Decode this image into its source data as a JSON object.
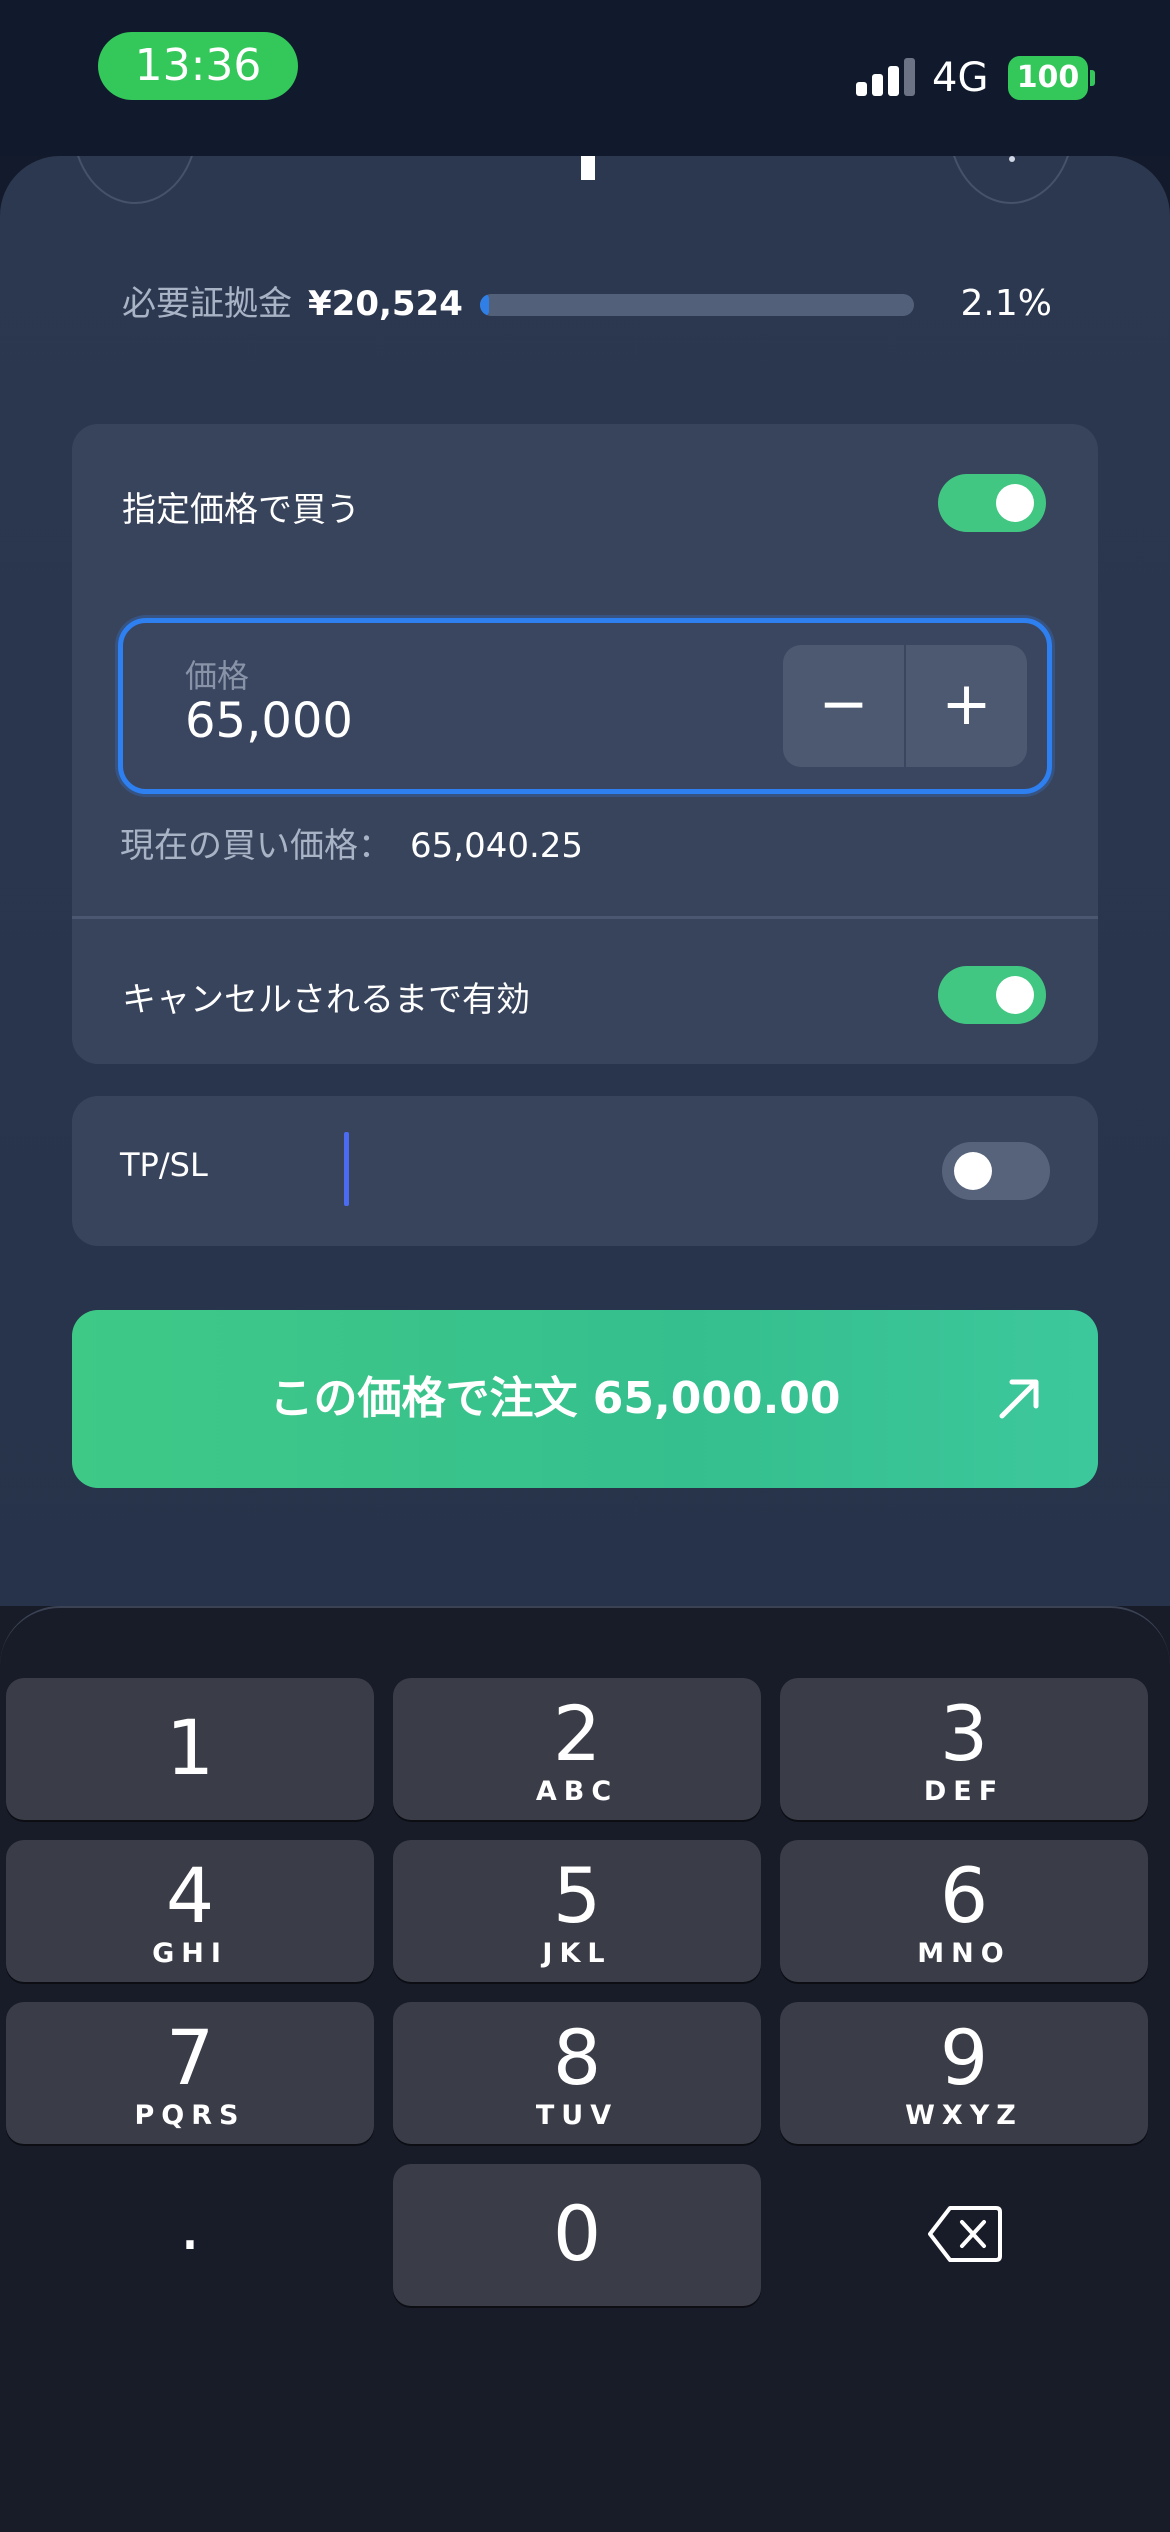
{
  "status_bar": {
    "time": "13:36",
    "network": "4G",
    "battery": "100",
    "time_pill_color": "#34c85a"
  },
  "margin": {
    "label": "必要証拠金",
    "value": "¥20,524",
    "percent": "2.1%",
    "fill_fraction": 0.021
  },
  "limit_order": {
    "label": "指定価格で買う",
    "toggle_on": true,
    "price_caption": "価格",
    "price_value": "65,000",
    "minus": "−",
    "plus": "+",
    "current_label": "現在の買い価格：",
    "current_value": "65,040.25"
  },
  "gtc": {
    "label": "キャンセルされるまで有効",
    "toggle_on": true
  },
  "tpsl": {
    "label": "TP/SL",
    "toggle_on": false
  },
  "order_button": {
    "label": "この価格で注文 65,000.00",
    "icon": "arrow-up-right-icon"
  },
  "keypad": {
    "keys": [
      {
        "digit": "1",
        "letters": ""
      },
      {
        "digit": "2",
        "letters": "ABC"
      },
      {
        "digit": "3",
        "letters": "DEF"
      },
      {
        "digit": "4",
        "letters": "GHI"
      },
      {
        "digit": "5",
        "letters": "JKL"
      },
      {
        "digit": "6",
        "letters": "MNO"
      },
      {
        "digit": "7",
        "letters": "PQRS"
      },
      {
        "digit": "8",
        "letters": "TUV"
      },
      {
        "digit": "9",
        "letters": "WXYZ"
      }
    ],
    "dot": ".",
    "zero": "0",
    "backspace_icon": "backspace-icon"
  },
  "colors": {
    "accent_green": "#42c783",
    "focus_blue": "#2e7ff0"
  }
}
